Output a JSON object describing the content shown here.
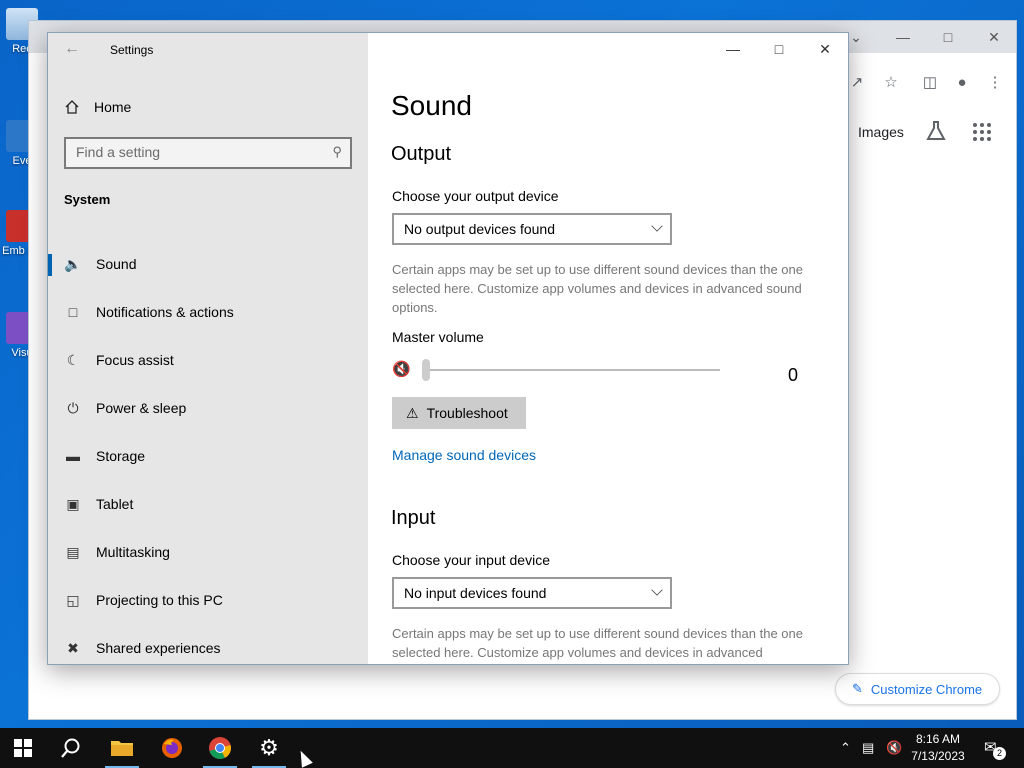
{
  "desktop": {
    "icons": [
      {
        "label": "Rec",
        "icon": "recycle-bin-icon"
      },
      {
        "label": "Eve",
        "icon": "shortcut-icon"
      },
      {
        "label": "Emb\nDe",
        "icon": "shortcut-icon"
      },
      {
        "label": "Visu",
        "icon": "visual-studio-icon"
      }
    ]
  },
  "chrome": {
    "images_label": "Images",
    "customize_label": "Customize Chrome"
  },
  "settings": {
    "app_title": "Settings",
    "home_label": "Home",
    "search_placeholder": "Find a setting",
    "section_title": "System",
    "nav_items": [
      {
        "label": "Sound",
        "icon": "speaker-icon",
        "active": true
      },
      {
        "label": "Notifications & actions",
        "icon": "notification-icon"
      },
      {
        "label": "Focus assist",
        "icon": "moon-icon"
      },
      {
        "label": "Power & sleep",
        "icon": "power-icon"
      },
      {
        "label": "Storage",
        "icon": "storage-icon"
      },
      {
        "label": "Tablet",
        "icon": "tablet-icon"
      },
      {
        "label": "Multitasking",
        "icon": "multitasking-icon"
      },
      {
        "label": "Projecting to this PC",
        "icon": "projector-icon"
      },
      {
        "label": "Shared experiences",
        "icon": "shared-icon"
      }
    ],
    "content": {
      "page_title": "Sound",
      "output_heading": "Output",
      "output_label": "Choose your output device",
      "output_value": "No output devices found",
      "output_help": "Certain apps may be set up to use different sound devices than the one selected here. Customize app volumes and devices in advanced sound options.",
      "master_volume_label": "Master volume",
      "volume_value": "0",
      "troubleshoot_label": "Troubleshoot",
      "manage_link": "Manage sound devices",
      "input_heading": "Input",
      "input_label": "Choose your input device",
      "input_value": "No input devices found",
      "input_help": "Certain apps may be set up to use different sound devices than the one selected here. Customize app volumes and devices in advanced"
    }
  },
  "taskbar": {
    "time": "8:16 AM",
    "date": "7/13/2023",
    "notification_count": "2"
  }
}
